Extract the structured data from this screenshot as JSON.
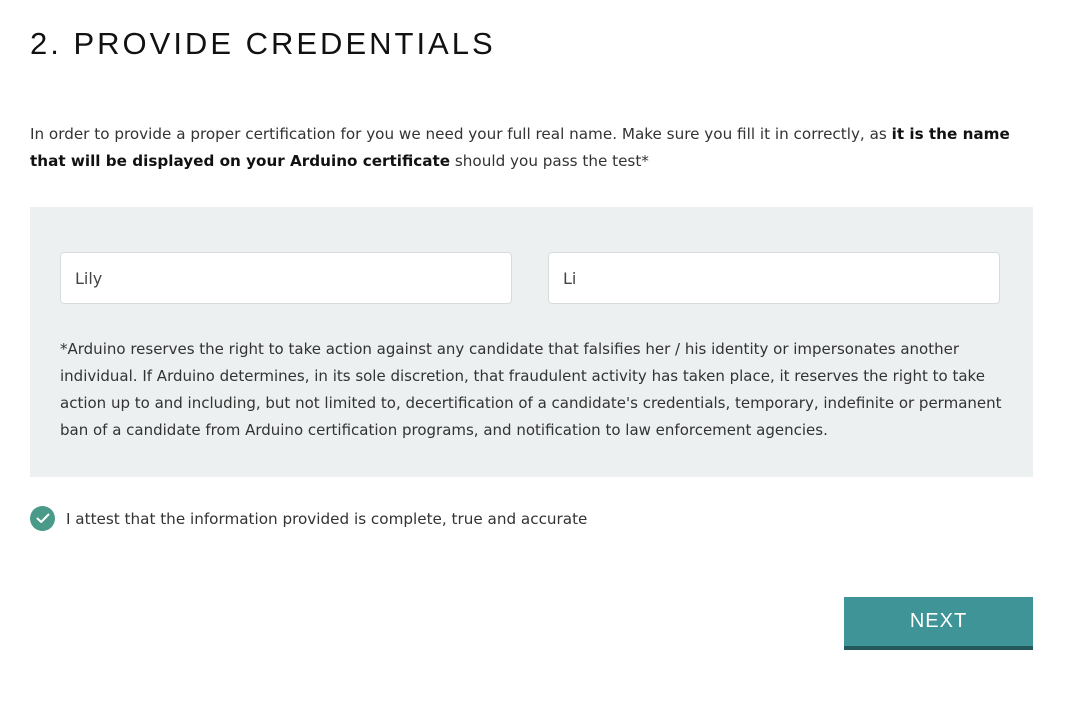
{
  "title": "2. PROVIDE CREDENTIALS",
  "intro": {
    "part1": "In order to provide a proper certification for you we need your full real name. Make sure you fill it in correctly, as ",
    "bold": "it is the name that will be displayed on your Arduino certificate",
    "part2": " should you pass the test*"
  },
  "form": {
    "first_name": "Lily",
    "last_name": "Li",
    "disclaimer": "*Arduino reserves the right to take action against any candidate that falsifies her / his identity or impersonates another individual. If Arduino determines, in its sole discretion, that fraudulent activity has taken place, it reserves the right to take action up to and including, but not limited to, decertification of a candidate's credentials, temporary, indefinite or permanent ban of a candidate from Arduino certification programs, and notification to law enforcement agencies."
  },
  "attest": {
    "label": "I attest that the information provided is complete, true and accurate",
    "checked": true,
    "icon": "check-circle-icon"
  },
  "next_label": "NEXT",
  "colors": {
    "accent": "#3f9498",
    "check": "#4a9a8a",
    "panel": "#ecf0f0"
  }
}
